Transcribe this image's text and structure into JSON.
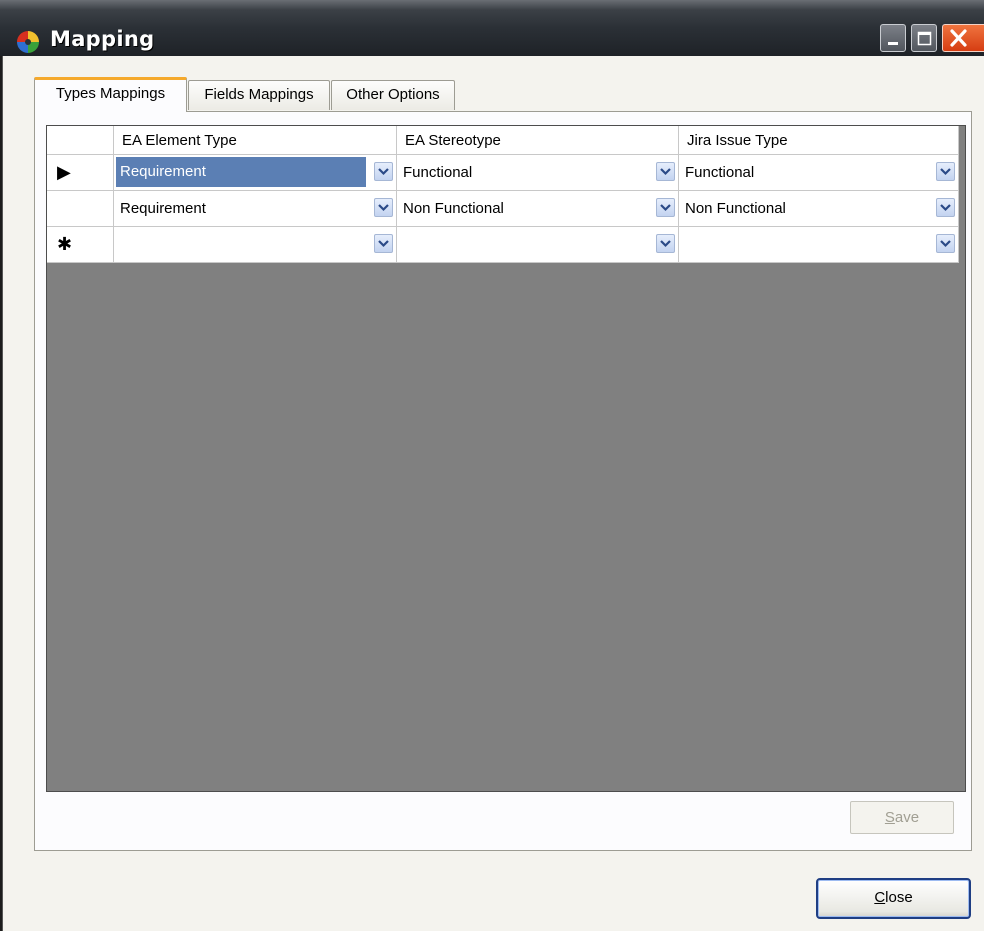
{
  "window": {
    "title": "Mapping",
    "colors": {
      "titlebar": "#2b3036",
      "close_button": "#e05020",
      "active_tab_accent": "#f5a92c",
      "selection": "#5b7fb4",
      "grid_background": "#808080"
    }
  },
  "tabs": [
    {
      "label": "Types Mappings",
      "active": true
    },
    {
      "label": "Fields Mappings",
      "active": false
    },
    {
      "label": "Other Options",
      "active": false
    }
  ],
  "grid": {
    "columns": [
      "EA Element Type",
      "EA Stereotype",
      "Jira Issue Type"
    ],
    "rows": [
      {
        "marker": "▶",
        "cells": [
          "Requirement",
          "Functional",
          "Functional"
        ],
        "selected_cell": 0
      },
      {
        "marker": "",
        "cells": [
          "Requirement",
          "Non Functional",
          "Non Functional"
        ]
      },
      {
        "marker": "✱",
        "cells": [
          "",
          "",
          ""
        ]
      }
    ]
  },
  "buttons": {
    "save": {
      "mnemonic": "S",
      "rest": "ave",
      "enabled": false
    },
    "close": {
      "mnemonic": "C",
      "rest": "lose",
      "enabled": true
    }
  },
  "icons": {
    "app": "app-logo-icon",
    "minimize": "minimize-icon",
    "maximize": "maximize-icon",
    "close": "close-icon",
    "dropdown": "chevron-down-icon"
  }
}
